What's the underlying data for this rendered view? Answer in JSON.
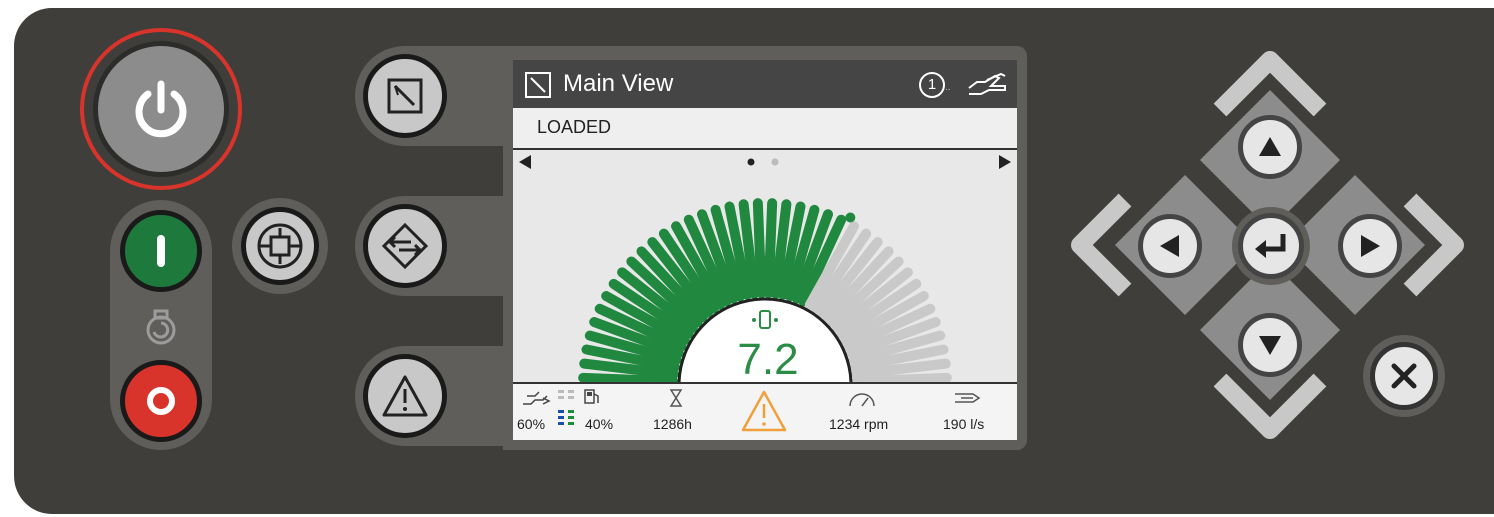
{
  "screen": {
    "title": "Main View",
    "status": "LOADED",
    "counter_badge": "1",
    "gauge": {
      "value": "7.2",
      "level": 0.65,
      "segments": 40,
      "active_color": "#21883f",
      "inactive_color": "#c9c9c9"
    },
    "page_indicator": {
      "pages": 2,
      "active": 0
    },
    "footer": {
      "percent_left": "60%",
      "percent_right": "40%",
      "hours": "1286h",
      "rpm": "1234 rpm",
      "flow": "190 l/s"
    }
  },
  "colors": {
    "panel": "#3f3e3a",
    "power_ring": "#d9342b",
    "start_button": "#1e7a3c",
    "stop_button": "#d9342b",
    "warning": "#f0a03a"
  },
  "icons": {
    "power": "power-icon",
    "start": "start-icon",
    "stop": "stop-icon",
    "motor": "motor-icon",
    "compressor": "compressor-icon",
    "main_view": "main-view-icon",
    "manual_mode": "hand-icon",
    "transfer": "transfer-icon",
    "warning": "warning-icon",
    "enter": "enter-icon",
    "close": "close-icon"
  }
}
